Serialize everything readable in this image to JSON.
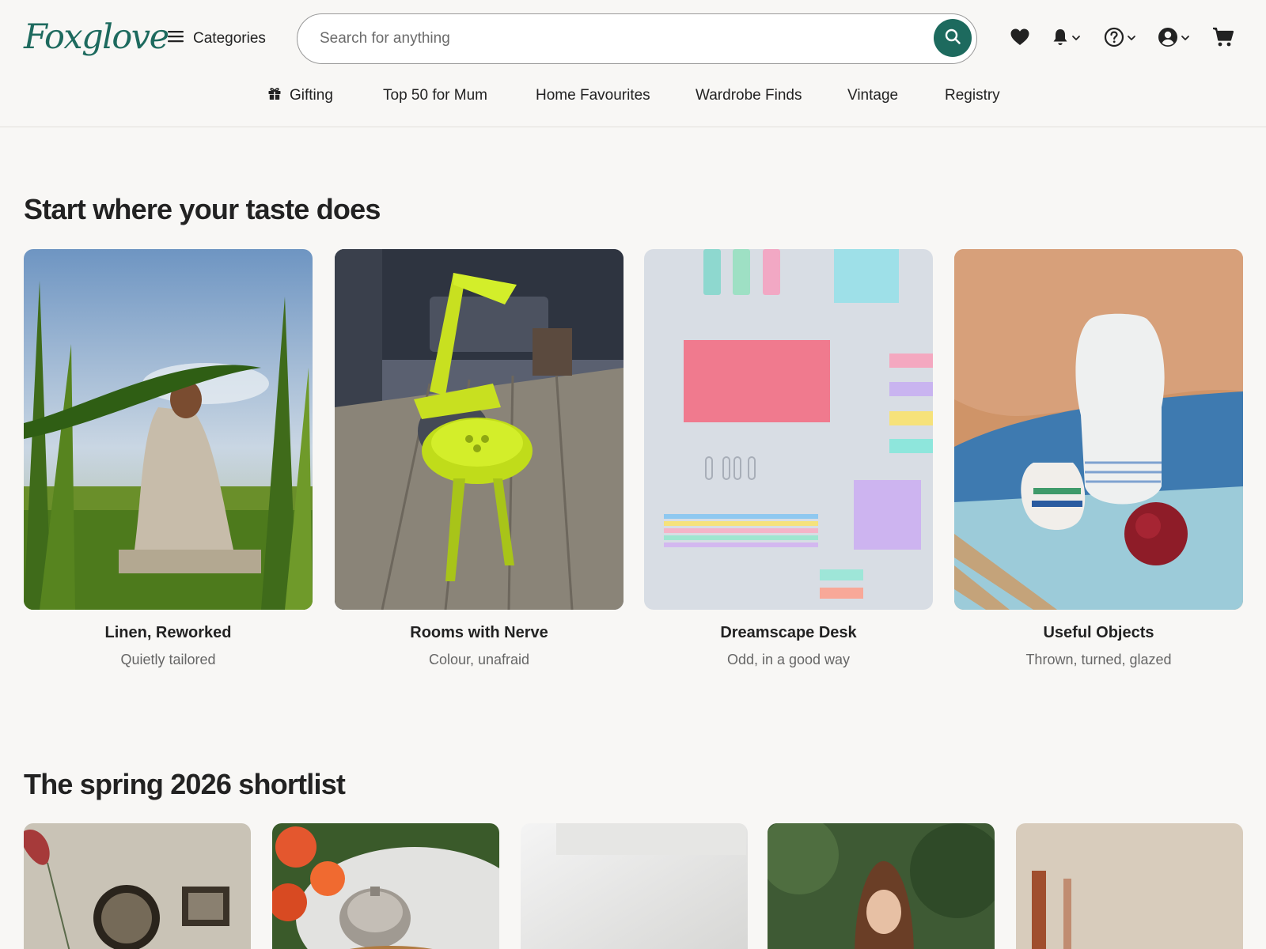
{
  "brand": {
    "name": "Foxglove"
  },
  "header": {
    "categories_label": "Categories",
    "search_placeholder": "Search for anything"
  },
  "icons": {
    "menu": "menu-icon",
    "search": "search-icon",
    "favourites": "heart-icon",
    "notifications": "bell-icon",
    "help": "help-icon",
    "account": "account-icon",
    "cart": "cart-icon",
    "gift": "gift-icon",
    "dropdown": "chevron-down-icon"
  },
  "nav": {
    "items": [
      {
        "label": "Gifting"
      },
      {
        "label": "Top 50 for Mum"
      },
      {
        "label": "Home Favourites"
      },
      {
        "label": "Wardrobe Finds"
      },
      {
        "label": "Vintage"
      },
      {
        "label": "Registry"
      }
    ]
  },
  "sections": {
    "taste": {
      "heading": "Start where your taste does",
      "cards": [
        {
          "title": "Linen, Reworked",
          "subtitle": "Quietly tailored"
        },
        {
          "title": "Rooms with Nerve",
          "subtitle": "Colour, unafraid"
        },
        {
          "title": "Dreamscape Desk",
          "subtitle": "Odd, in a good way"
        },
        {
          "title": "Useful Objects",
          "subtitle": "Thrown, turned, glazed"
        }
      ]
    },
    "shortlist": {
      "heading": "The spring 2026 shortlist"
    }
  },
  "colors": {
    "brand": "#1d6a5e",
    "background": "#f8f7f5",
    "text": "#222222",
    "muted": "#666666",
    "border": "#e2e0dc"
  }
}
